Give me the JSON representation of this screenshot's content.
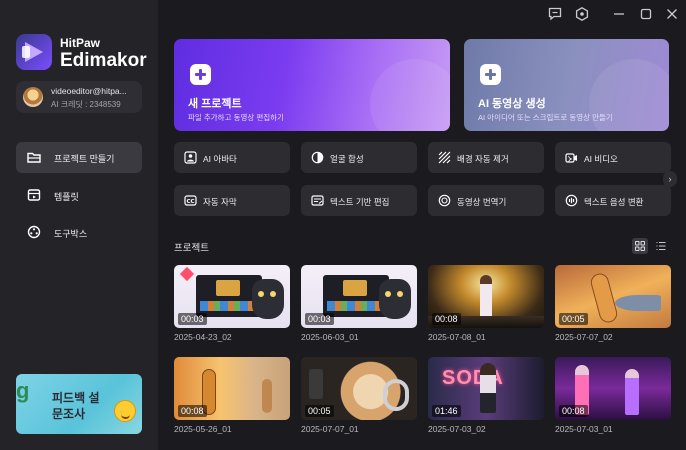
{
  "brand": {
    "line1": "HitPaw",
    "line2": "Edimakor"
  },
  "account": {
    "email": "videoeditor@hitpa...",
    "credits": "AI 크레딧 : 2348539"
  },
  "nav": [
    {
      "label": "프로젝트 만들기",
      "icon": "folder-icon",
      "active": true
    },
    {
      "label": "템플릿",
      "icon": "template-icon",
      "active": false
    },
    {
      "label": "도구박스",
      "icon": "toolbox-icon",
      "active": false
    }
  ],
  "feedback": {
    "line1": "피드백 설",
    "line2": "문조사",
    "badge": "g"
  },
  "hero": {
    "new": {
      "title": "새 프로젝트",
      "subtitle": "파일 추가하고 동영상 편집하기"
    },
    "ai": {
      "title": "AI 동영상 생성",
      "subtitle": "AI 아이디어 또는 스크립트로 동영상 만들기"
    }
  },
  "tools": [
    {
      "label": "AI 아바타",
      "icon": "avatar-icon"
    },
    {
      "label": "얼굴 합성",
      "icon": "face-swap-icon"
    },
    {
      "label": "배경 자동 제거",
      "icon": "background-remove-icon"
    },
    {
      "label": "AI 비디오",
      "icon": "ai-video-icon"
    },
    {
      "label": "자동 자막",
      "icon": "subtitle-icon"
    },
    {
      "label": "텍스트 기반 편집",
      "icon": "text-edit-icon"
    },
    {
      "label": "동영상 번역기",
      "icon": "translate-icon"
    },
    {
      "label": "텍스트 음성 변환",
      "icon": "text-to-speech-icon"
    }
  ],
  "projects_title": "프로젝트",
  "projects": [
    {
      "duration": "00:03",
      "date": "2025-04-23_02"
    },
    {
      "duration": "00:03",
      "date": "2025-06-03_01"
    },
    {
      "duration": "00:08",
      "date": "2025-07-08_01"
    },
    {
      "duration": "00:05",
      "date": "2025-07-07_02"
    },
    {
      "duration": "00:08",
      "date": "2025-05-26_01"
    },
    {
      "duration": "00:05",
      "date": "2025-07-07_01"
    },
    {
      "duration": "01:46",
      "date": "2025-07-03_02"
    },
    {
      "duration": "00:08",
      "date": "2025-07-03_01"
    }
  ],
  "thumb_text": {
    "soda": "SODA"
  },
  "colors": {
    "accent": "#7b3cf0",
    "sidebar": "#232328",
    "background": "#1b1b1f"
  }
}
